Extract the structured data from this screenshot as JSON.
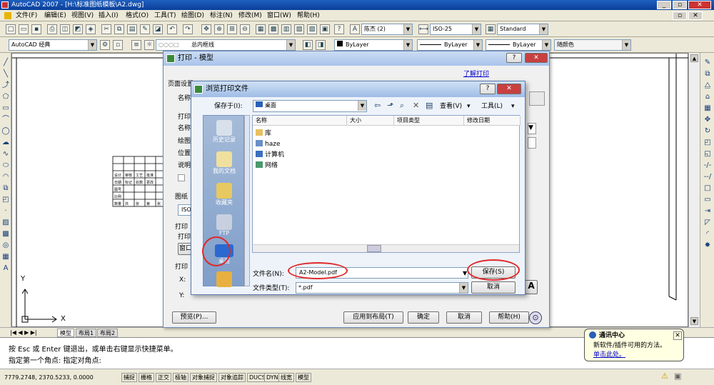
{
  "window": {
    "title": "AutoCAD 2007 - [H:\\标准图纸模板\\A2.dwg]",
    "controls": [
      "_",
      "▫",
      "✕"
    ]
  },
  "menu": [
    "文件(F)",
    "编辑(E)",
    "视图(V)",
    "插入(I)",
    "格式(O)",
    "工具(T)",
    "绘图(D)",
    "标注(N)",
    "修改(M)",
    "窗口(W)",
    "帮助(H)"
  ],
  "toolbar1": {
    "text_style": "陈杰 (2)",
    "dim_style": "ISO-25",
    "table_style": "Standard"
  },
  "toolbar2": {
    "workspace": "AutoCAD 经典",
    "layer": "总内框线",
    "color": "ByLayer",
    "linetype": "ByLayer",
    "lineweight": "ByLayer",
    "plotstyle": "随颜色"
  },
  "drawing": {
    "ucs_y": "Y",
    "ucs_x": "X",
    "table_cells": [
      "设计",
      "审核",
      "工艺",
      "批准",
      "日期",
      "图号",
      "比例",
      "数量",
      "共",
      "张",
      "第",
      "张",
      "标记",
      "处数",
      "更改"
    ]
  },
  "layout_tabs": [
    "模型",
    "布局1",
    "布局2"
  ],
  "command": {
    "line1": "按 Esc 或 Enter 键退出，或单击右键显示快捷菜单。",
    "line2": "指定第一个角点: 指定对角点:"
  },
  "status": {
    "coords": "7779.2748, 2370.5233, 0.0000",
    "buttons": [
      "捕捉",
      "栅格",
      "正交",
      "极轴",
      "对象捕捉",
      "对象追踪",
      "DUCS",
      "DYN",
      "线宽",
      "模型"
    ]
  },
  "plot_dialog": {
    "title": "打印 - 模型",
    "help_link": "了解打印",
    "page_setup": "页面设置",
    "name_label": "名称",
    "printer_label": "打印",
    "name2_label": "名称",
    "plotter_label": "绘图",
    "where_label": "位置",
    "desc_label": "说明",
    "paper_label": "图纸",
    "paper_value": "ISO",
    "plot_area_label": "打印",
    "plot_area2": "打印",
    "window_btn": "窗口",
    "offset_label": "打印",
    "x_label": "X:",
    "y_label": "Y:",
    "preview_btn": "预览(P)...",
    "apply_btn": "应用到布局(T)",
    "ok_btn": "确定",
    "cancel_btn": "取消",
    "help_btn": "帮助(H)",
    "a_btn": "A"
  },
  "browse_dialog": {
    "title": "浏览打印文件",
    "save_in_label": "保存于(I):",
    "save_in_value": "桌面",
    "view_label": "查看(V)",
    "tools_label": "工具(L)",
    "places": [
      "历史记录",
      "我的文档",
      "收藏夹",
      "FTP",
      "桌面",
      ""
    ],
    "columns": [
      "名称",
      "大小",
      "项目类型",
      "修改日期"
    ],
    "files": [
      "库",
      "haze",
      "计算机",
      "网络"
    ],
    "filename_label": "文件名(N):",
    "filename_value": "A2-Model.pdf",
    "filetype_label": "文件类型(T):",
    "filetype_value": "*.pdf",
    "save_btn": "保存(S)",
    "cancel_btn": "取消"
  },
  "balloon": {
    "title": "通讯中心",
    "text": "新软件/插件可用的方法。",
    "link": "单击此处。"
  },
  "colors": {
    "red_annotation": "#e0282a",
    "title_blue": "#0a3f9a"
  }
}
